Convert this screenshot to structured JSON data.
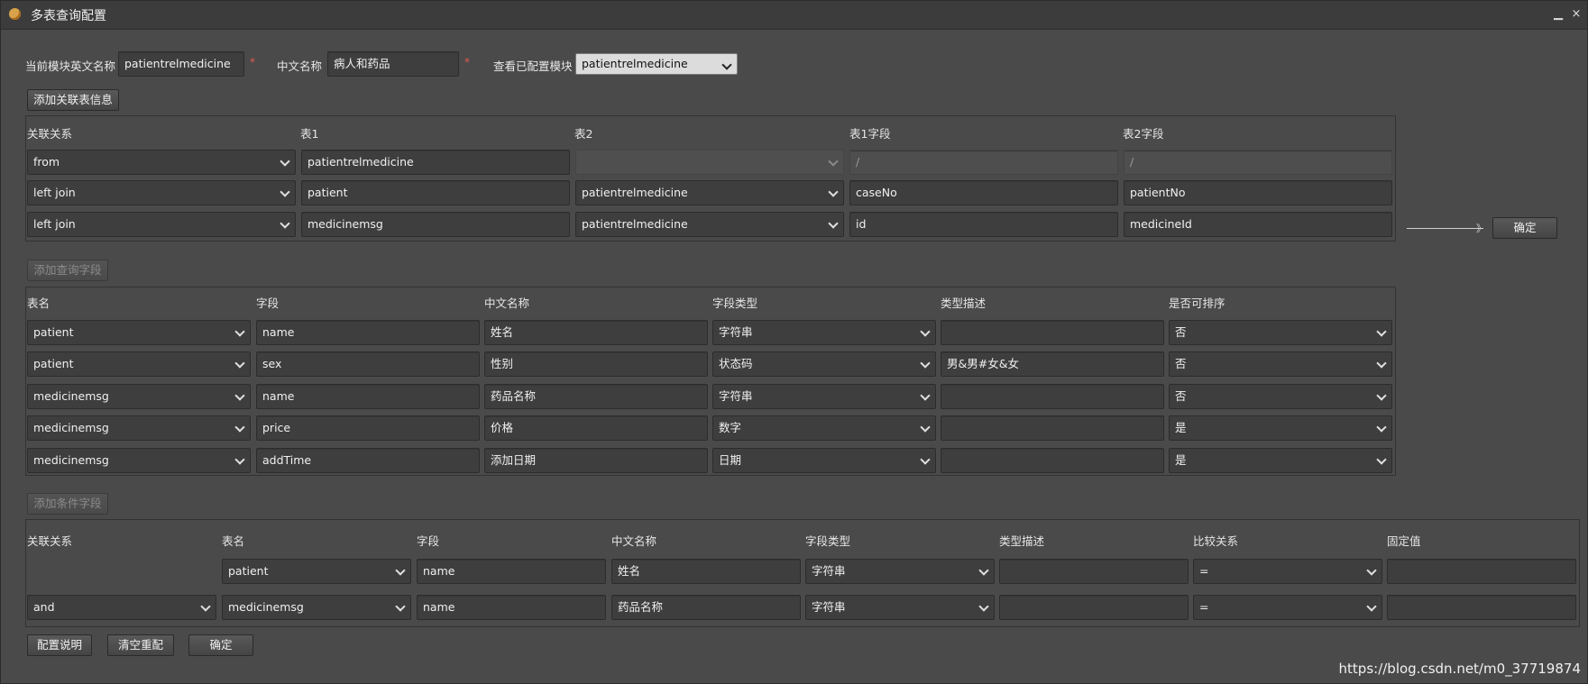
{
  "window": {
    "title": "多表查询配置",
    "minimize_label": "▁",
    "close_label": "×"
  },
  "top": {
    "en_label": "当前模块英文名称",
    "en_value": "patientrelmedicine",
    "cn_label": "中文名称",
    "cn_value": "病人和药品",
    "view_label": "查看已配置模块",
    "view_value": "patientrelmedicine",
    "required_mark": "*"
  },
  "relations": {
    "add_button": "添加关联表信息",
    "headers": [
      "关联关系",
      "表1",
      "表2",
      "表1字段",
      "表2字段"
    ],
    "rows": [
      {
        "relation": "from",
        "table1": "patientrelmedicine",
        "table2": "",
        "field1": "/",
        "field2": "/"
      },
      {
        "relation": "left join",
        "table1": "patient",
        "table2": "patientrelmedicine",
        "field1": "caseNo",
        "field2": "patientNo"
      },
      {
        "relation": "left join",
        "table1": "medicinemsg",
        "table2": "patientrelmedicine",
        "field1": "id",
        "field2": "medicineId"
      }
    ],
    "confirm_button": "确定",
    "arrow_head": "》"
  },
  "query_fields": {
    "add_button": "添加查询字段",
    "headers": [
      "表名",
      "字段",
      "中文名称",
      "字段类型",
      "类型描述",
      "是否可排序"
    ],
    "rows": [
      {
        "table": "patient",
        "field": "name",
        "cn_name": "姓名",
        "type": "字符串",
        "desc": "",
        "sortable": "否"
      },
      {
        "table": "patient",
        "field": "sex",
        "cn_name": "性别",
        "type": "状态码",
        "desc": "男&男#女&女",
        "sortable": "否"
      },
      {
        "table": "medicinemsg",
        "field": "name",
        "cn_name": "药品名称",
        "type": "字符串",
        "desc": "",
        "sortable": "否"
      },
      {
        "table": "medicinemsg",
        "field": "price",
        "cn_name": "价格",
        "type": "数字",
        "desc": "",
        "sortable": "是"
      },
      {
        "table": "medicinemsg",
        "field": "addTime",
        "cn_name": "添加日期",
        "type": "日期",
        "desc": "",
        "sortable": "是"
      }
    ]
  },
  "conditions": {
    "add_button": "添加条件字段",
    "headers": [
      "关联关系",
      "表名",
      "字段",
      "中文名称",
      "字段类型",
      "类型描述",
      "比较关系",
      "固定值"
    ],
    "rows": [
      {
        "relation": "",
        "table": "patient",
        "field": "name",
        "cn_name": "姓名",
        "type": "字符串",
        "desc": "",
        "compare": "=",
        "fixed": ""
      },
      {
        "relation": "and",
        "table": "medicinemsg",
        "field": "name",
        "cn_name": "药品名称",
        "type": "字符串",
        "desc": "",
        "compare": "=",
        "fixed": ""
      }
    ]
  },
  "bottom": {
    "help_button": "配置说明",
    "reset_button": "清空重配",
    "confirm_button": "确定"
  },
  "watermark": "https://blog.csdn.net/m0_37719874"
}
